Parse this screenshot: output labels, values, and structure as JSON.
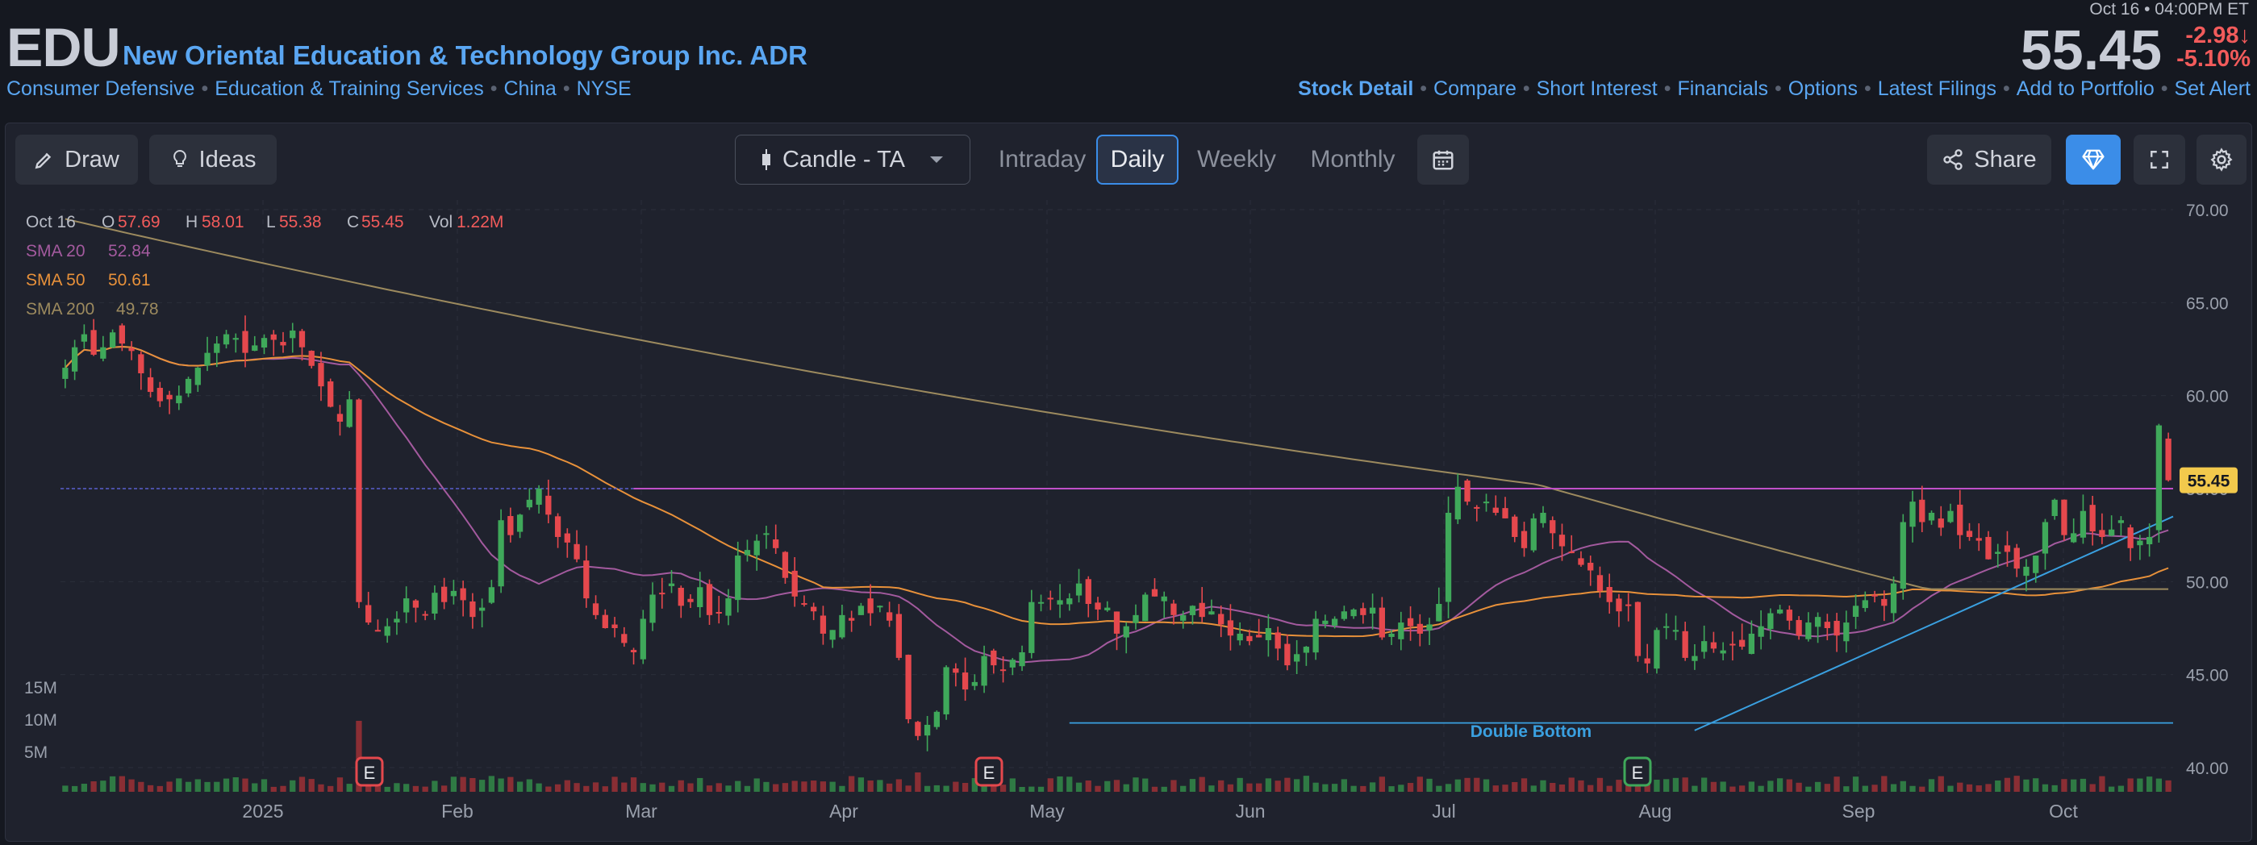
{
  "header": {
    "ticker": "EDU",
    "company": "New Oriental Education & Technology Group Inc. ADR",
    "tags": [
      "Consumer Defensive",
      "Education & Training Services",
      "China",
      "NYSE"
    ],
    "timestamp": "Oct 16 • 04:00PM ET",
    "price": "55.45",
    "change": "-2.98",
    "change_pct": "-5.10%",
    "change_arrow": "↓",
    "nav": [
      "Stock Detail",
      "Compare",
      "Short Interest",
      "Financials",
      "Options",
      "Latest Filings",
      "Add to Portfolio",
      "Set Alert"
    ]
  },
  "toolbar": {
    "draw": "Draw",
    "ideas": "Ideas",
    "chart_type": "Candle - TA",
    "ranges": [
      "Intraday",
      "Daily",
      "Weekly",
      "Monthly"
    ],
    "selected_range": "Daily",
    "share": "Share"
  },
  "legend": {
    "date": "Oct 16",
    "o_label": "O",
    "o": "57.69",
    "h_label": "H",
    "h": "58.01",
    "l_label": "L",
    "l": "55.38",
    "c_label": "C",
    "c": "55.45",
    "vol_label": "Vol",
    "vol": "1.22M",
    "sma20_label": "SMA 20",
    "sma20": "52.84",
    "sma50_label": "SMA 50",
    "sma50": "50.61",
    "sma200_label": "SMA 200",
    "sma200": "49.78"
  },
  "colors": {
    "up": "#3fa85a",
    "down": "#e5484d",
    "sma20": "#a35a9e",
    "sma50": "#e8913a",
    "sma200": "#9c8a5e",
    "resistance": "#c050c8",
    "support": "#3aa0e0",
    "accent": "#3b8de8"
  },
  "chart_data": {
    "type": "candlestick",
    "price_axis": {
      "min": 40,
      "max": 70,
      "ticks": [
        "70.00",
        "65.00",
        "60.00",
        "55.00",
        "50.00",
        "45.00",
        "40.00"
      ]
    },
    "volume_axis": {
      "ticks": [
        "15M",
        "10M",
        "5M"
      ]
    },
    "x_labels": [
      "2025",
      "Feb",
      "Mar",
      "Apr",
      "May",
      "Jun",
      "Jul",
      "Aug",
      "Sep",
      "Oct"
    ],
    "current_price_tag": "55.45",
    "annotation": "Double Bottom",
    "earnings_marker": "E",
    "horizontal_lines": [
      55.0,
      42.4
    ],
    "trendline": {
      "from": [
        0.7735,
        42.0
      ],
      "to": [
        1.0,
        53.5
      ]
    },
    "closes": [
      61.5,
      62.6,
      63.3,
      62.2,
      62.6,
      63.4,
      62.8,
      62.4,
      61.2,
      60.2,
      59.7,
      59.8,
      60.0,
      60.9,
      61.5,
      62.3,
      62.8,
      63.3,
      63.1,
      62.3,
      62.7,
      63.1,
      63.0,
      62.7,
      63.5,
      62.6,
      61.6,
      60.5,
      59.4,
      58.6,
      59.8,
      48.9,
      47.8,
      47.4,
      47.6,
      48.0,
      49.1,
      48.6,
      48.2,
      49.4,
      48.9,
      49.5,
      49.0,
      48.1,
      48.6,
      49.7,
      53.3,
      52.5,
      53.6,
      54.4,
      55.0,
      53.6,
      52.4,
      52.1,
      51.2,
      49.1,
      48.2,
      47.5,
      47.5,
      46.7,
      46.2,
      48.0,
      49.3,
      49.4,
      49.9,
      48.7,
      48.9,
      49.7,
      48.2,
      48.3,
      49.1,
      51.4,
      51.7,
      52.2,
      52.6,
      51.8,
      50.2,
      49.2,
      48.8,
      48.4,
      47.2,
      47.4,
      48.2,
      47.9,
      48.7,
      48.3,
      48.7,
      47.9,
      45.9,
      42.6,
      41.7,
      42.3,
      43.0,
      45.4,
      45.1,
      44.2,
      44.6,
      46.0,
      45.5,
      45.2,
      45.8,
      46.2,
      48.9,
      48.9,
      49.1,
      49.0,
      49.1,
      49.9,
      48.8,
      48.5,
      48.6,
      47.2,
      47.6,
      48.2,
      49.3,
      49.2,
      49.2,
      48.2,
      48.2,
      48.7,
      48.1,
      48.4,
      47.7,
      47.1,
      47.2,
      46.8,
      47.0,
      47.5,
      46.4,
      45.5,
      46.1,
      46.5,
      48.0,
      47.9,
      48.0,
      48.4,
      48.5,
      48.2,
      48.6,
      47.0,
      47.2,
      47.8,
      47.6,
      47.2,
      47.7,
      48.8,
      53.7,
      55.1,
      54.3,
      54.0,
      54.3,
      53.7,
      53.4,
      52.4,
      51.8,
      53.4,
      53.7,
      52.6,
      51.9,
      51.6,
      50.9,
      50.6,
      49.5,
      48.9,
      48.4,
      48.7,
      46.0,
      45.6,
      47.4,
      47.6,
      47.4,
      45.9,
      46.0,
      46.8,
      46.4,
      46.3,
      46.6,
      46.5,
      47.2,
      47.6,
      48.3,
      48.5,
      47.9,
      47.1,
      47.8,
      48.1,
      47.5,
      47.1,
      47.8,
      48.7,
      49.0,
      49.2,
      48.7,
      49.9,
      53.2,
      54.3,
      53.2,
      53.7,
      52.9,
      53.8,
      52.5,
      52.4,
      52.2,
      51.2,
      51.6,
      51.6,
      50.7,
      50.8,
      51.4,
      53.2,
      54.4,
      52.5,
      52.6,
      53.8,
      52.7,
      52.4,
      52.8,
      53.3,
      51.8,
      52.2,
      52.4,
      58.4,
      55.45
    ]
  }
}
